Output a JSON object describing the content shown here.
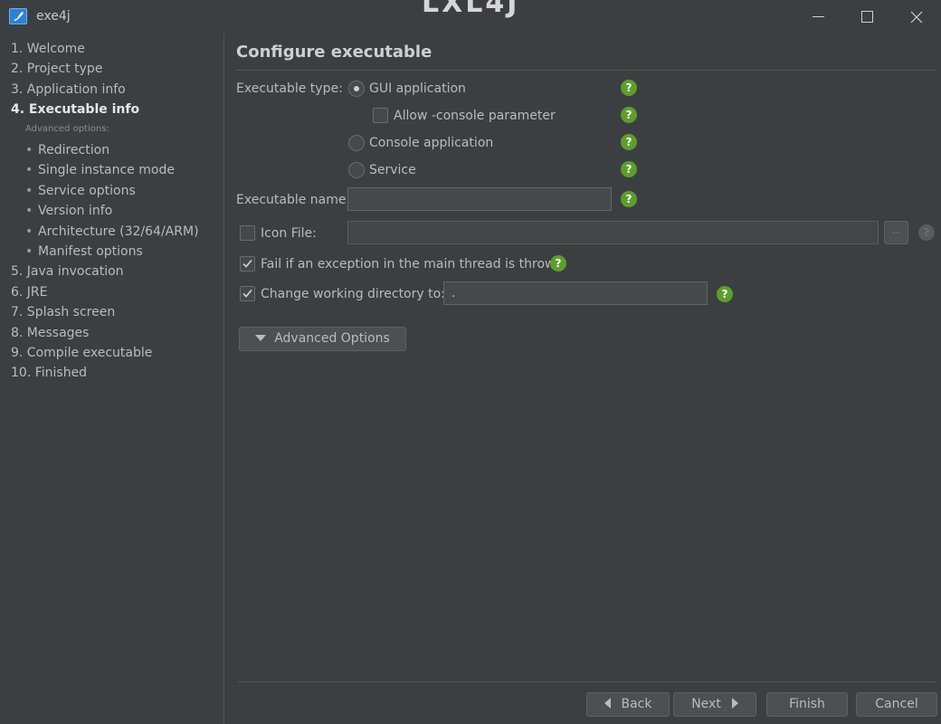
{
  "window": {
    "title": "exe4j",
    "title_ghost": "LXL4J"
  },
  "sidebar": {
    "items": [
      {
        "label": "1. Welcome"
      },
      {
        "label": "2. Project type"
      },
      {
        "label": "3. Application info"
      },
      {
        "label": "4. Executable info",
        "active": true
      },
      {
        "label": "5. Java invocation"
      },
      {
        "label": "6. JRE"
      },
      {
        "label": "7. Splash screen"
      },
      {
        "label": "8. Messages"
      },
      {
        "label": "9. Compile executable"
      },
      {
        "label": "10. Finished"
      }
    ],
    "advanced_header": "Advanced options:",
    "advanced_items": [
      {
        "label": "Redirection"
      },
      {
        "label": "Single instance mode"
      },
      {
        "label": "Service options"
      },
      {
        "label": "Version info"
      },
      {
        "label": "Architecture (32/64/ARM)"
      },
      {
        "label": "Manifest options"
      }
    ],
    "bullet": "•"
  },
  "main": {
    "title": "Configure executable",
    "executable_type_label": "Executable type:",
    "options": {
      "gui": {
        "label": "GUI application",
        "checked": true
      },
      "allow_console": {
        "label": "Allow -console parameter",
        "checked": false
      },
      "console": {
        "label": "Console application",
        "checked": false
      },
      "service": {
        "label": "Service",
        "checked": false
      }
    },
    "executable_name_label": "Executable name:",
    "executable_name_value": "",
    "icon_file_label": "Icon File:",
    "icon_file_checked": false,
    "icon_file_value": "",
    "browse_label": "...",
    "fail_exception_label": "Fail if an exception in the main thread is thrown",
    "fail_exception_checked": true,
    "change_dir_label": "Change working directory to:",
    "change_dir_checked": true,
    "change_dir_value": ".",
    "advanced_options_label": "Advanced Options",
    "help_glyph": "?"
  },
  "footer": {
    "back_label": "Back",
    "next_label": "Next",
    "finish_label": "Finish",
    "cancel_label": "Cancel"
  },
  "colors": {
    "background": "#3c3f41",
    "help_green": "#5d9e2b",
    "input_bg": "#45494a",
    "button_bg": "#4c5052"
  }
}
